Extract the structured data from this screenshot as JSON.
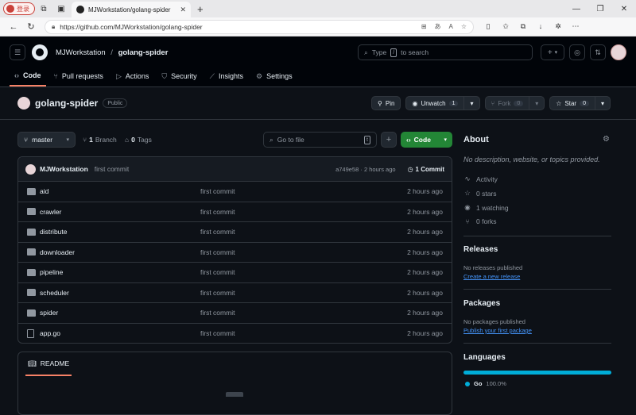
{
  "browser": {
    "profile_label": "登录",
    "tab_title": "MJWorkstation/golang-spider",
    "url": "https://github.com/MJWorkstation/golang-spider"
  },
  "header": {
    "owner": "MJWorkstation",
    "separator": "/",
    "repo": "golang-spider",
    "search_placeholder_prefix": "Type",
    "search_kbd": "/",
    "search_placeholder_suffix": "to search",
    "nav": [
      {
        "label": "Code",
        "icon": "code-icon"
      },
      {
        "label": "Pull requests",
        "icon": "pull-request-icon"
      },
      {
        "label": "Actions",
        "icon": "play-icon"
      },
      {
        "label": "Security",
        "icon": "shield-icon"
      },
      {
        "label": "Insights",
        "icon": "graph-icon"
      },
      {
        "label": "Settings",
        "icon": "gear-icon"
      }
    ]
  },
  "repo": {
    "name": "golang-spider",
    "visibility": "Public",
    "pin_label": "Pin",
    "unwatch_label": "Unwatch",
    "watch_count": "1",
    "fork_label": "Fork",
    "fork_count": "0",
    "star_label": "Star",
    "star_count": "0"
  },
  "toolbar": {
    "branch": "master",
    "branches_count": "1",
    "branches_label": "Branch",
    "tags_count": "0",
    "tags_label": "Tags",
    "goto_placeholder": "Go to file",
    "goto_kbd": "t",
    "code_label": "Code"
  },
  "commit": {
    "author": "MJWorkstation",
    "message": "first commit",
    "meta": "a749e58 · 2 hours ago",
    "count_label": "1 Commit"
  },
  "files": [
    {
      "name": "aid",
      "type": "dir",
      "message": "first commit",
      "time": "2 hours ago"
    },
    {
      "name": "crawler",
      "type": "dir",
      "message": "first commit",
      "time": "2 hours ago"
    },
    {
      "name": "distribute",
      "type": "dir",
      "message": "first commit",
      "time": "2 hours ago"
    },
    {
      "name": "downloader",
      "type": "dir",
      "message": "first commit",
      "time": "2 hours ago"
    },
    {
      "name": "pipeline",
      "type": "dir",
      "message": "first commit",
      "time": "2 hours ago"
    },
    {
      "name": "scheduler",
      "type": "dir",
      "message": "first commit",
      "time": "2 hours ago"
    },
    {
      "name": "spider",
      "type": "dir",
      "message": "first commit",
      "time": "2 hours ago"
    },
    {
      "name": "app.go",
      "type": "file",
      "message": "first commit",
      "time": "2 hours ago"
    }
  ],
  "readme": {
    "label": "README"
  },
  "about": {
    "title": "About",
    "description": "No description, website, or topics provided.",
    "stats": [
      {
        "label": "Activity",
        "icon": "pulse-icon"
      },
      {
        "label": "0 stars",
        "icon": "star-icon"
      },
      {
        "label": "1 watching",
        "icon": "eye-icon"
      },
      {
        "label": "0 forks",
        "icon": "fork-icon"
      }
    ]
  },
  "releases": {
    "title": "Releases",
    "note": "No releases published",
    "link": "Create a new release"
  },
  "packages": {
    "title": "Packages",
    "note": "No packages published",
    "link": "Publish your first package"
  },
  "languages": {
    "title": "Languages",
    "items": [
      {
        "name": "Go",
        "percent": "100.0%",
        "color": "#00add8"
      }
    ]
  },
  "colors": {
    "accent_green": "#238636",
    "link_blue": "#4493f8",
    "tab_underline": "#f78166"
  }
}
